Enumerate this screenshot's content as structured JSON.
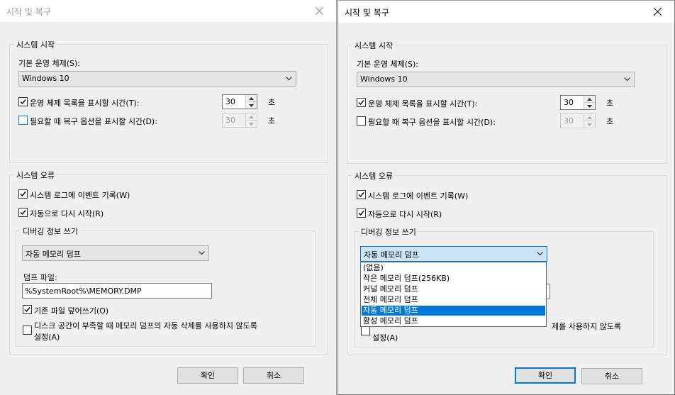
{
  "dialog": {
    "title": "시작 및 복구",
    "startup": {
      "group_title": "시스템 시작",
      "default_os_label": "기본 운영 체제(S):",
      "default_os_value": "Windows 10",
      "show_list_label": "운영 체제 목록을 표시할 시간(T):",
      "show_list_value": "30",
      "show_recovery_label": "필요할 때 복구 옵션을 표시할 시간(D):",
      "show_recovery_value": "30",
      "unit": "초"
    },
    "failure": {
      "group_title": "시스템 오류",
      "write_event_label": "시스템 로그에 이벤트 기록(W)",
      "auto_restart_label": "자동으로 다시 시작(R)",
      "debug_group_title": "디버깅 정보 쓰기",
      "debug_type_value": "자동 메모리 덤프",
      "dump_file_label": "덤프 파일:",
      "dump_file_value": "%SystemRoot%\\MEMORY.DMP",
      "overwrite_label": "기존 파일 덮어쓰기(O)",
      "disable_auto_delete_label_1": "디스크 공간이 부족할 때 메모리 덤프의 자동 삭제를 사용하지 않도록",
      "disable_auto_delete_label_2": "설정(A)",
      "obscured_right_label": "제를 사용하지 않도록"
    },
    "ok_label": "확인",
    "cancel_label": "취소"
  },
  "dropdown_options": [
    "(없음)",
    "작은 메모리 덤프(256KB)",
    "커널 메모리 덤프",
    "전체 메모리 덤프",
    "자동 메모리 덤프",
    "활성 메모리 덤프"
  ],
  "dropdown_selected": "자동 메모리 덤프",
  "checkbox_state": {
    "show_list": true,
    "show_recovery": false,
    "write_event": true,
    "auto_restart": true,
    "overwrite": true,
    "disable_auto_delete": false
  },
  "colors": {
    "accent": "#0078d7",
    "selection": "#cce4f7"
  }
}
